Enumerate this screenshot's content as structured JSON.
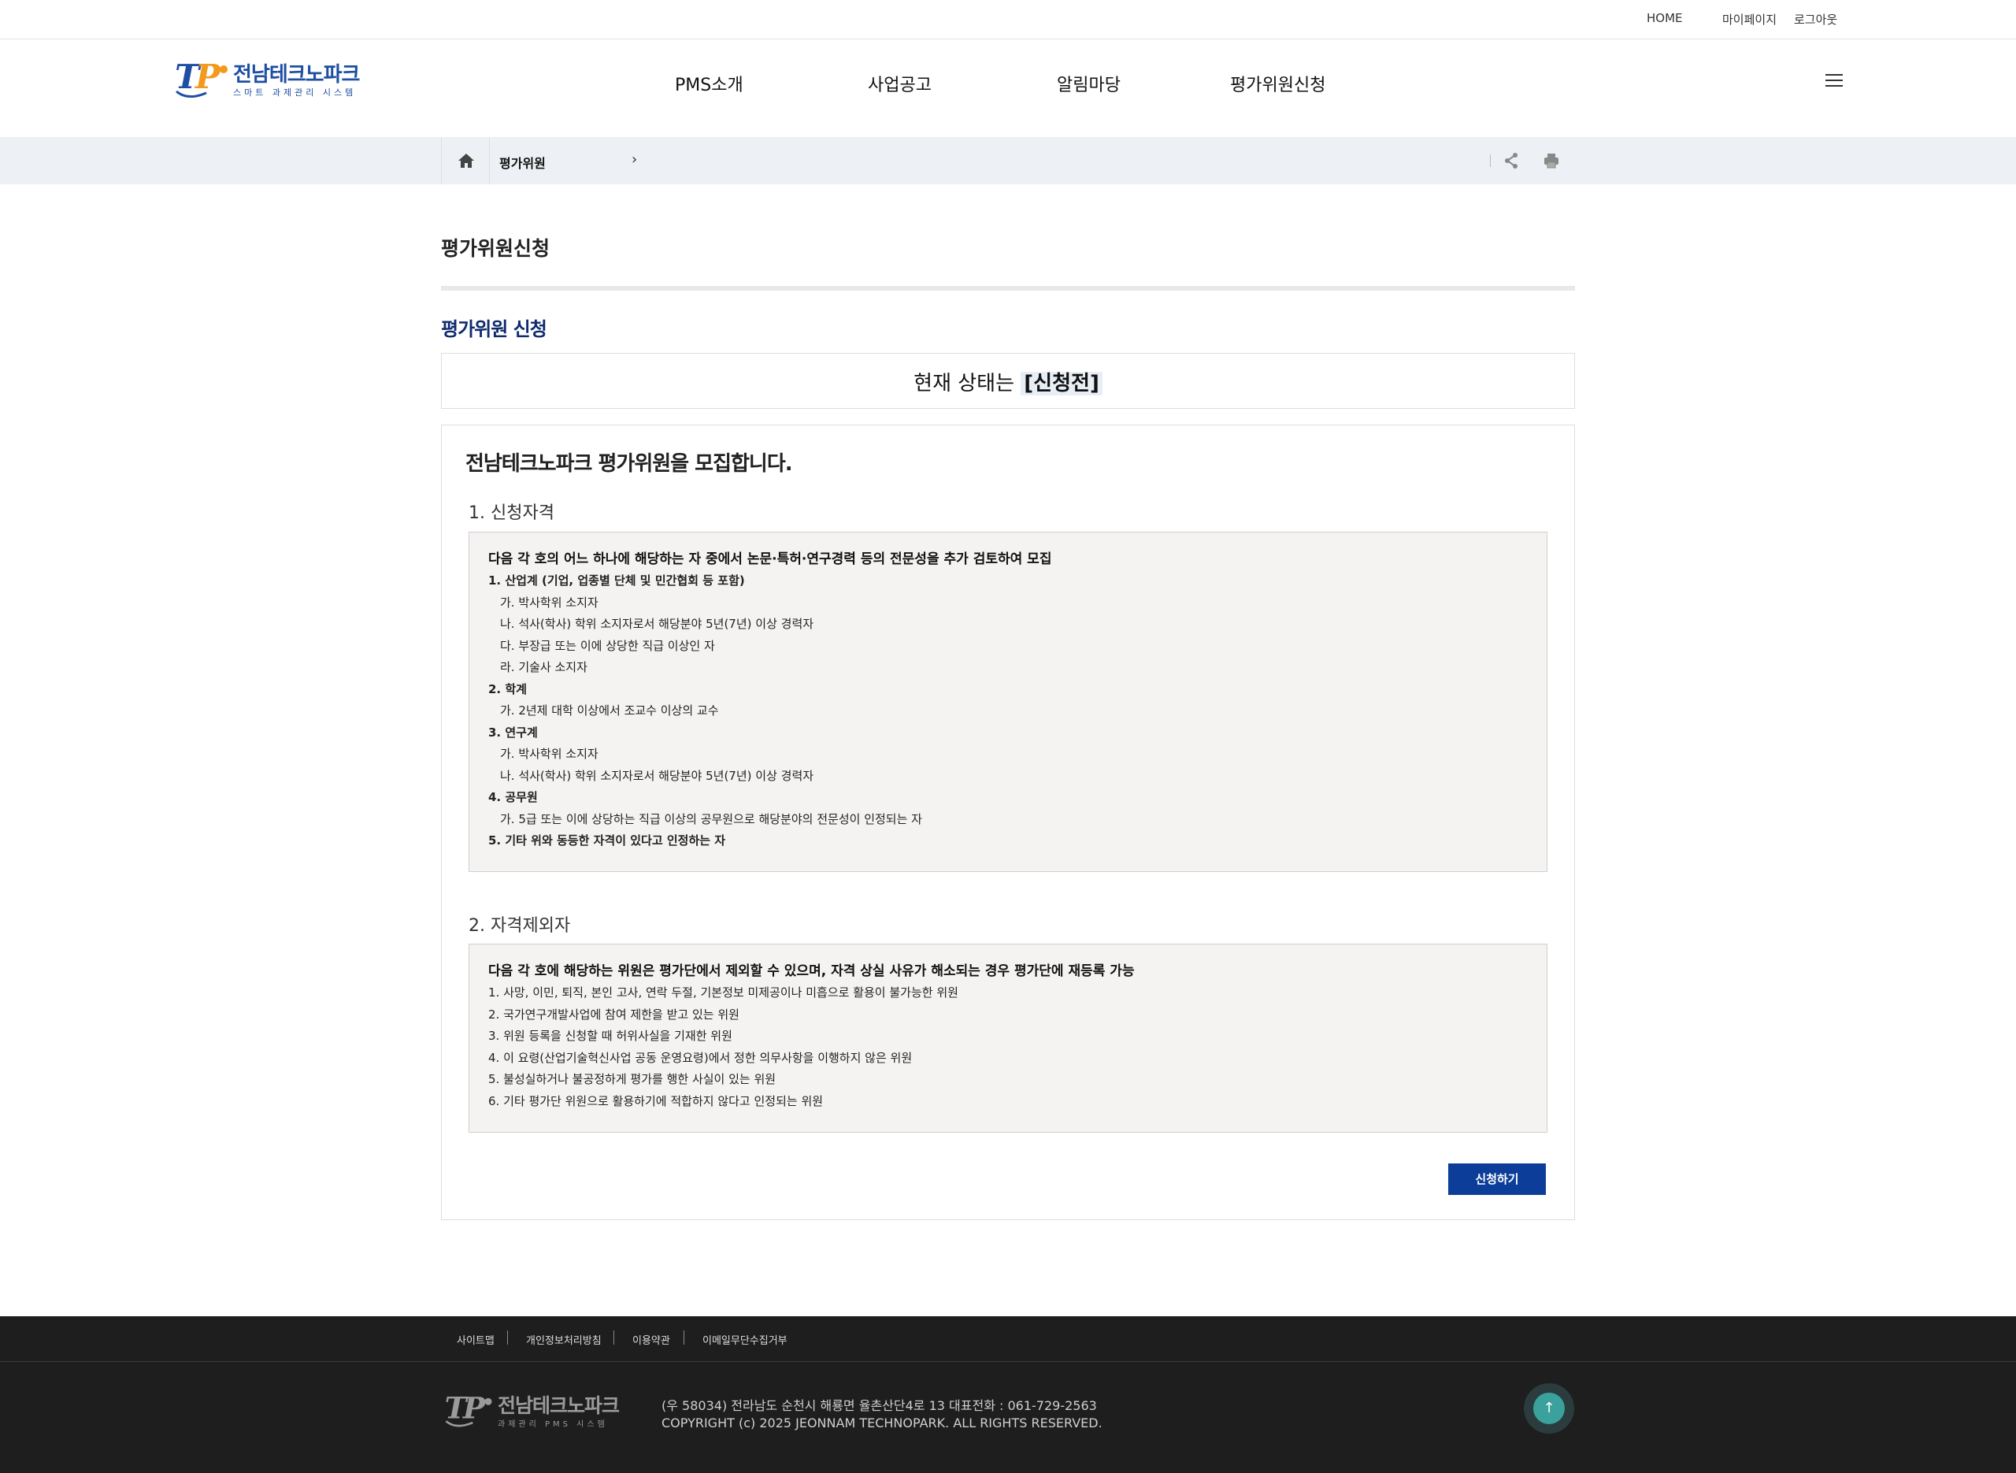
{
  "topbar": {
    "home": "HOME",
    "mypage": "마이페이지",
    "logout": "로그아웃"
  },
  "header": {
    "logo_mark": "TP",
    "logo_title": "전남테크노파크",
    "logo_subtitle": "스마트 과제관리 시스템",
    "nav": [
      "PMS소개",
      "사업공고",
      "알림마당",
      "평가위원신청"
    ],
    "menu_icon": "hamburger-icon"
  },
  "breadcrumb": {
    "home_icon": "home-icon",
    "current": "평가위원",
    "arrow": "›",
    "share_icon": "share-icon",
    "print_icon": "print-icon"
  },
  "page": {
    "title": "평가위원신청",
    "section_title": "평가위원 신청",
    "status_prefix": "현재 상태는",
    "status_value": "[신청전]",
    "recruit_title": "전남테크노파크 평가위원을 모집합니다.",
    "qualification": {
      "heading": "1. 신청자격",
      "intro": "다음 각 호의 어느 하나에 해당하는 자 중에서 논문·특허·연구경력 등의 전문성을 추가 검토하여 모집",
      "lines": [
        {
          "text": "1. 산업계 (기업, 업종별 단체 및 민간협회 등 포함)",
          "style": "bold"
        },
        {
          "text": "가. 박사학위 소지자",
          "style": "indent"
        },
        {
          "text": "나. 석사(학사) 학위 소지자로서 해당분야 5년(7년) 이상 경력자",
          "style": "indent"
        },
        {
          "text": "다. 부장급 또는 이에 상당한 직급 이상인 자",
          "style": "indent"
        },
        {
          "text": "라. 기술사 소지자",
          "style": "indent"
        },
        {
          "text": "2. 학계",
          "style": "bold"
        },
        {
          "text": "가. 2년제 대학 이상에서 조교수 이상의 교수",
          "style": "indent"
        },
        {
          "text": "3. 연구계",
          "style": "bold"
        },
        {
          "text": "가. 박사학위 소지자",
          "style": "indent"
        },
        {
          "text": "나. 석사(학사) 학위 소지자로서 해당분야 5년(7년) 이상 경력자",
          "style": "indent"
        },
        {
          "text": "4. 공무원",
          "style": "bold"
        },
        {
          "text": "가. 5급 또는 이에 상당하는 직급 이상의 공무원으로 해당분야의 전문성이 인정되는 자",
          "style": "indent"
        },
        {
          "text": "5. 기타 위와 동등한 자격이 있다고 인정하는 자",
          "style": "bold"
        }
      ]
    },
    "exclusion": {
      "heading": "2. 자격제외자",
      "intro": "다음 각 호에 해당하는 위원은 평가단에서 제외할 수 있으며, 자격 상실 사유가 해소되는 경우 평가단에 재등록 가능",
      "lines": [
        {
          "text": "1. 사망, 이민, 퇴직, 본인 고사, 연락 두절, 기본정보 미제공이나 미흡으로 활용이 불가능한 위원",
          "style": "plain"
        },
        {
          "text": "2. 국가연구개발사업에 참여 제한을 받고 있는 위원",
          "style": "plain"
        },
        {
          "text": "3. 위원 등록을 신청할 때 허위사실을 기재한 위원",
          "style": "plain"
        },
        {
          "text": "4. 이 요령(산업기술혁신사업 공동 운영요령)에서 정한 의무사항을 이행하지 않은 위원",
          "style": "plain"
        },
        {
          "text": "5. 불성실하거나 불공정하게 평가를 행한 사실이 있는 위원",
          "style": "plain"
        },
        {
          "text": "6. 기타 평가단 위원으로 활용하기에 적합하지 않다고 인정되는 위원",
          "style": "plain"
        }
      ]
    },
    "apply_button": "신청하기"
  },
  "footer": {
    "links": [
      "사이트맵",
      "개인정보처리방침",
      "이용약관",
      "이메일무단수집거부"
    ],
    "logo_mark": "TP",
    "logo_title": "전남테크노파크",
    "logo_subtitle": "과제관리 PMS 시스템",
    "address": "(우 58034) 전라남도 순천시 해룡면 율촌산단4로 13   대표전화 : 061-729-2563",
    "copyright": "COPYRIGHT (c) 2025 JEONNAM TECHNOPARK. ALL RIGHTS RESERVED.",
    "top_icon": "arrow-up-icon"
  },
  "colors": {
    "brand_blue": "#1e4fa3",
    "orange": "#f39a1e",
    "section_navy": "#0f2a6e",
    "button_blue": "#0c3e99",
    "footer_bg": "#1e1e1e",
    "top_button": "#3aa19c"
  }
}
